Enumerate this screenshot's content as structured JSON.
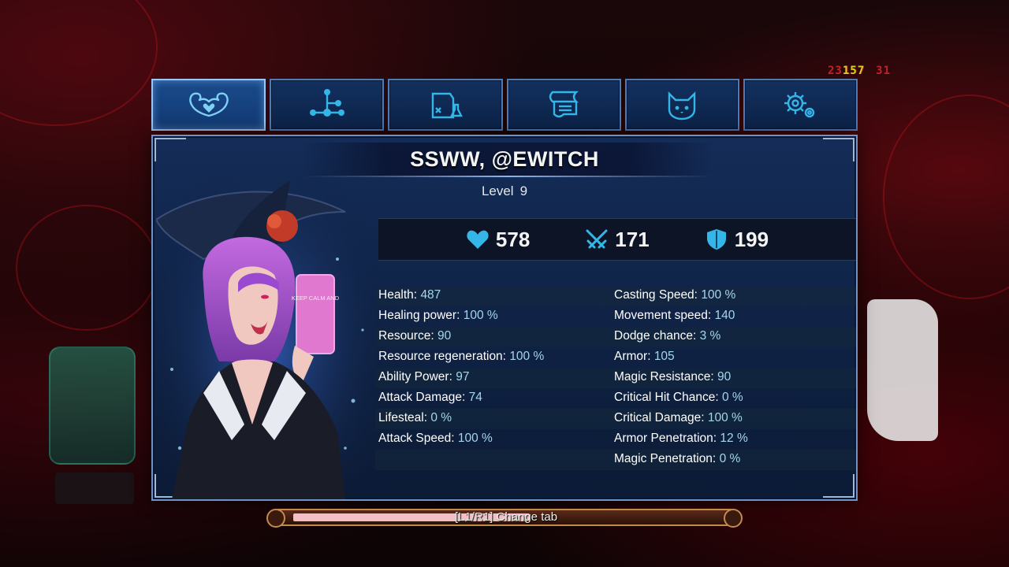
{
  "overlay": {
    "fps_a": "23",
    "fps_b": "157",
    "fps_c": "31"
  },
  "tabs": [
    {
      "name": "character",
      "icon": "muscle-heart-icon",
      "active": true
    },
    {
      "name": "talents",
      "icon": "skill-tree-icon",
      "active": false
    },
    {
      "name": "inventory",
      "icon": "bag-potion-icon",
      "active": false
    },
    {
      "name": "quests",
      "icon": "scroll-icon",
      "active": false
    },
    {
      "name": "pet",
      "icon": "cat-icon",
      "active": false
    },
    {
      "name": "settings",
      "icon": "gears-icon",
      "active": false
    }
  ],
  "character": {
    "name": "SSWW, @EWITCH",
    "level_label": "Level",
    "level": "9",
    "phone_text": "KEEP CALM AND"
  },
  "summary": {
    "health": "578",
    "attack": "171",
    "defense": "199"
  },
  "stats": {
    "left": [
      {
        "label": "Health:",
        "value": "487"
      },
      {
        "label": "Healing power:",
        "value": "100 %"
      },
      {
        "label": "Resource:",
        "value": "90"
      },
      {
        "label": "Resource regeneration:",
        "value": "100 %"
      },
      {
        "label": "Ability Power:",
        "value": "97"
      },
      {
        "label": "Attack Damage:",
        "value": "74"
      },
      {
        "label": "Lifesteal:",
        "value": "0 %"
      },
      {
        "label": "Attack Speed:",
        "value": "100 %"
      }
    ],
    "right": [
      {
        "label": "Casting Speed:",
        "value": "100 %"
      },
      {
        "label": "Movement speed:",
        "value": "140"
      },
      {
        "label": "Dodge chance:",
        "value": "3 %"
      },
      {
        "label": "Armor:",
        "value": "105"
      },
      {
        "label": "Magic Resistance:",
        "value": "90"
      },
      {
        "label": "Critical Hit Chance:",
        "value": "0 %"
      },
      {
        "label": "Critical Damage:",
        "value": "100 %"
      },
      {
        "label": "Armor Penetration:",
        "value": "12 %"
      },
      {
        "label": "Magic Penetration:",
        "value": "0 %"
      }
    ]
  },
  "hint": {
    "key": "[L1/R1]",
    "label": "Change tab"
  },
  "colors": {
    "panel": "#0f2244",
    "tab_border": "#4d7bb8",
    "stat_value": "#a6d6ec",
    "icon_cyan": "#35b6e8"
  }
}
